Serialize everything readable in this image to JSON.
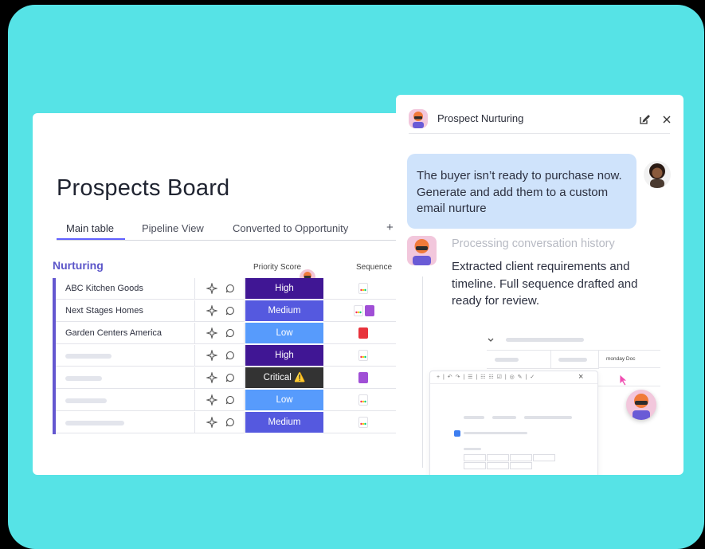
{
  "board": {
    "title": "Prospects Board",
    "tabs": [
      {
        "label": "Main table",
        "active": true
      },
      {
        "label": "Pipeline View",
        "active": false
      },
      {
        "label": "Converted to Opportunity",
        "active": false
      }
    ],
    "add_tab": "+",
    "group_title": "Nurturing",
    "columns": {
      "priority": "Priority Score",
      "sequence": "Sequence"
    },
    "rows": [
      {
        "name": "ABC Kitchen Goods",
        "priority": "High",
        "priority_color": "#401694",
        "sequence": [
          "monday"
        ]
      },
      {
        "name": "Next Stages Homes",
        "priority": "Medium",
        "priority_color": "#5559df",
        "sequence": [
          "monday",
          "form"
        ]
      },
      {
        "name": "Garden Centers America",
        "priority": "Low",
        "priority_color": "#579bfc",
        "sequence": [
          "pdf"
        ]
      },
      {
        "name": "",
        "priority": "High",
        "priority_color": "#401694",
        "sequence": [
          "monday"
        ]
      },
      {
        "name": "",
        "priority": "Critical ⚠️",
        "priority_color": "#333333",
        "sequence": [
          "form"
        ]
      },
      {
        "name": "",
        "priority": "Low",
        "priority_color": "#579bfc",
        "sequence": [
          "monday"
        ]
      },
      {
        "name": "",
        "priority": "Medium",
        "priority_color": "#5559df",
        "sequence": [
          "monday"
        ]
      }
    ]
  },
  "panel": {
    "title": "Prospect Nurturing",
    "user_message": "The buyer isn’t ready to purchase now. Generate and add them to a custom email nurture",
    "processing": "Processing conversation history",
    "agent_reply": "Extracted client requirements and timeline. Full sequence drafted and ready for review.",
    "mini_column_label": "monday Doc",
    "editor_close": "×"
  },
  "icons": {
    "edit": "edit-icon",
    "close": "close-icon",
    "sparkle": "sparkle-icon",
    "comment": "comment-icon",
    "chevron": "chevron-down-icon"
  },
  "colors": {
    "background": "#56e3e6",
    "accent": "#6161ff",
    "bubble": "#cfe3fb",
    "high": "#401694",
    "medium": "#5559df",
    "low": "#579bfc",
    "critical": "#333333"
  }
}
